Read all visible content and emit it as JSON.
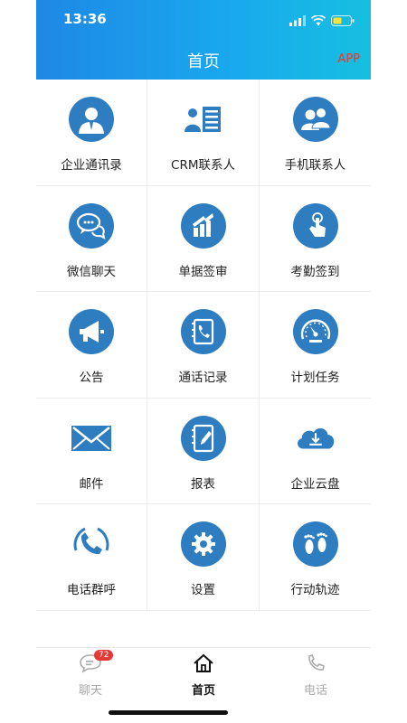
{
  "status": {
    "time": "13:36"
  },
  "header": {
    "title": "首页",
    "app_link": "APP"
  },
  "grid": {
    "items": [
      {
        "label": "企业通讯录",
        "icon": "company-contacts-icon"
      },
      {
        "label": "CRM联系人",
        "icon": "crm-contact-icon"
      },
      {
        "label": "手机联系人",
        "icon": "phone-contacts-icon"
      },
      {
        "label": "微信聊天",
        "icon": "wechat-chat-icon"
      },
      {
        "label": "单据签审",
        "icon": "document-approval-icon"
      },
      {
        "label": "考勤签到",
        "icon": "attendance-checkin-icon"
      },
      {
        "label": "公告",
        "icon": "announcement-icon"
      },
      {
        "label": "通话记录",
        "icon": "call-log-icon"
      },
      {
        "label": "计划任务",
        "icon": "plan-task-icon"
      },
      {
        "label": "邮件",
        "icon": "mail-icon"
      },
      {
        "label": "报表",
        "icon": "report-icon"
      },
      {
        "label": "企业云盘",
        "icon": "cloud-drive-icon"
      },
      {
        "label": "电话群呼",
        "icon": "group-call-icon"
      },
      {
        "label": "设置",
        "icon": "settings-icon"
      },
      {
        "label": "行动轨迹",
        "icon": "footprint-icon"
      }
    ]
  },
  "tabbar": {
    "chat": {
      "label": "聊天",
      "badge": "72"
    },
    "home": {
      "label": "首页"
    },
    "phone": {
      "label": "电话"
    }
  },
  "colors": {
    "accent": "#2f7dc1",
    "header_start": "#1e88e5",
    "header_end": "#16bfe0",
    "badge": "#e53935",
    "app_link": "#e53935"
  }
}
